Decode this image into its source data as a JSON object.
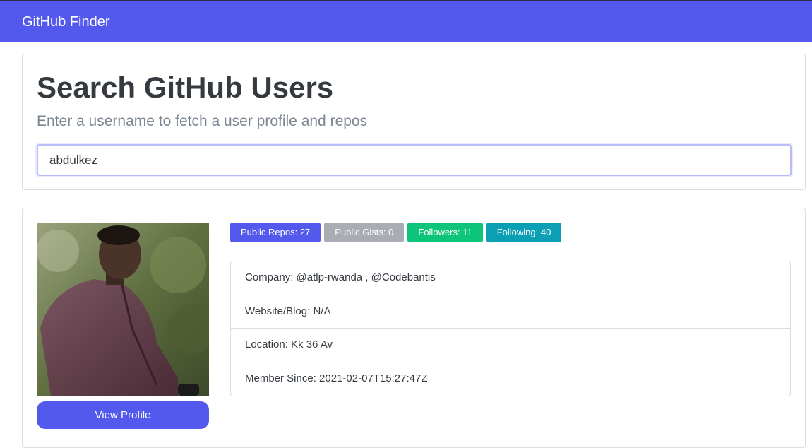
{
  "app": {
    "brand": "GitHub Finder"
  },
  "search": {
    "heading": "Search GitHub Users",
    "lead": "Enter a username to fetch a user profile and repos",
    "value": "abdulkez"
  },
  "profile": {
    "view_button": "View Profile",
    "badges": {
      "repos": "Public Repos: 27",
      "gists": "Public Gists: 0",
      "followers": "Followers: 11",
      "following": "Following: 40"
    },
    "info": {
      "company": "Company: @atlp-rwanda , @Codebantis",
      "website": "Website/Blog: N/A",
      "location": "Location: Kk 36 Av",
      "member_since": "Member Since: 2021-02-07T15:27:47Z"
    }
  },
  "colors": {
    "primary": "#5459ee",
    "secondary": "#a9adb3",
    "success": "#0cc47a",
    "info": "#0b9fb6"
  }
}
